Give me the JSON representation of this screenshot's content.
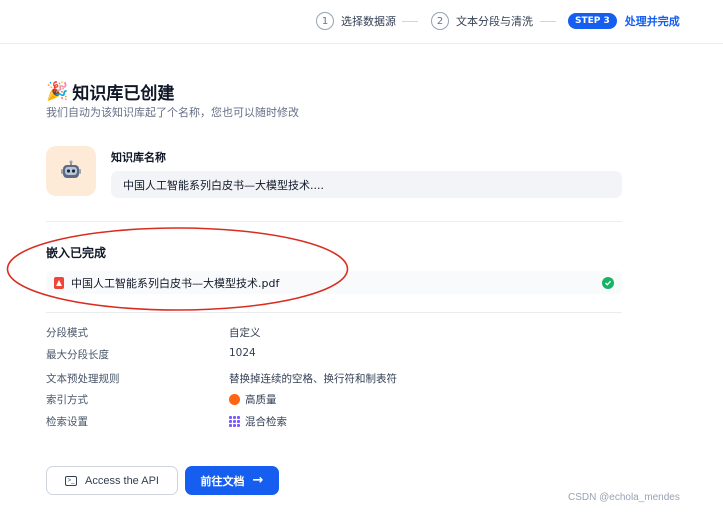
{
  "stepper": {
    "step1": {
      "num": "1",
      "label": "选择数据源"
    },
    "step2": {
      "num": "2",
      "label": "文本分段与清洗"
    },
    "step3": {
      "pill": "STEP 3",
      "label": "处理并完成"
    }
  },
  "header": {
    "icon": "party-popper-icon",
    "title": "知识库已创建",
    "subtitle": "我们自动为该知识库起了个名称，您也可以随时修改"
  },
  "knowledge_base": {
    "icon": "robot-icon",
    "name_label": "知识库名称",
    "name_value": "中国人工智能系列白皮书—大模型技术...."
  },
  "embedding": {
    "title": "嵌入已完成",
    "file_name": "中国人工智能系列白皮书—大模型技术.pdf",
    "status_icon": "check-circle-icon",
    "highlight_color": "#d92d20"
  },
  "properties": [
    {
      "key": "分段模式",
      "value": "自定义"
    },
    {
      "key": "最大分段长度",
      "value": "1024"
    },
    {
      "key": "文本预处理规则",
      "value": "替换掉连续的空格、换行符和制表符"
    },
    {
      "key": "索引方式",
      "value": "高质量"
    },
    {
      "key": "检索设置",
      "value": "混合检索"
    }
  ],
  "actions": {
    "api_label": "Access the API",
    "doc_label": "前往文档"
  },
  "watermark": "CSDN @echola_mendes",
  "colors": {
    "accent": "#155eef",
    "success": "#16b364",
    "pdf": "#f04438"
  }
}
